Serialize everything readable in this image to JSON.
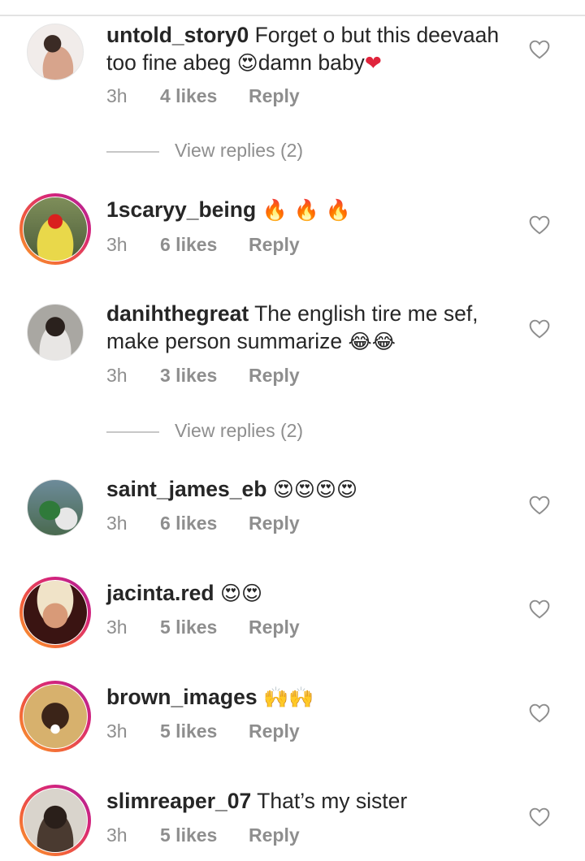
{
  "comments": [
    {
      "username": "untold_story0",
      "text": "Forget o but this deevaah too fine abeg",
      "emoji_1": "😍",
      "text_2": "damn baby",
      "emoji_2": "❤",
      "time": "3h",
      "likes": "4 likes",
      "reply": "Reply",
      "story_ring": false
    },
    {
      "username": "1scaryy_being",
      "text": "",
      "emoji_1": "🔥 🔥 🔥",
      "time": "3h",
      "likes": "6 likes",
      "reply": "Reply",
      "story_ring": true
    },
    {
      "username": "danihthegreat",
      "text": "The english tire me sef, make person summarize",
      "emoji_1": "😂😂",
      "time": "3h",
      "likes": "3 likes",
      "reply": "Reply",
      "story_ring": false
    },
    {
      "username": "saint_james_eb",
      "text": "",
      "emoji_1": "😍😍😍😍",
      "time": "3h",
      "likes": "6 likes",
      "reply": "Reply",
      "story_ring": false
    },
    {
      "username": "jacinta.red",
      "text": "",
      "emoji_1": "😍😍",
      "time": "3h",
      "likes": "5 likes",
      "reply": "Reply",
      "story_ring": true
    },
    {
      "username": "brown_images",
      "text": "",
      "emoji_1": "🙌🙌",
      "time": "3h",
      "likes": "5 likes",
      "reply": "Reply",
      "story_ring": true
    },
    {
      "username": "slimreaper_07",
      "text": "That’s my sister",
      "emoji_1": "",
      "time": "3h",
      "likes": "5 likes",
      "reply": "Reply",
      "story_ring": true
    }
  ],
  "view_replies": [
    {
      "label": "View replies (2)"
    },
    {
      "label": "View replies (2)"
    }
  ],
  "icons": {
    "like": "heart-outline-icon"
  },
  "colors": {
    "username": "#262626",
    "meta": "#8e8e8e",
    "heart_outline": "#8e8e8e",
    "story_ring_start": "#f9a22c",
    "story_ring_end": "#a8259c",
    "red_heart": "#e0243c"
  }
}
